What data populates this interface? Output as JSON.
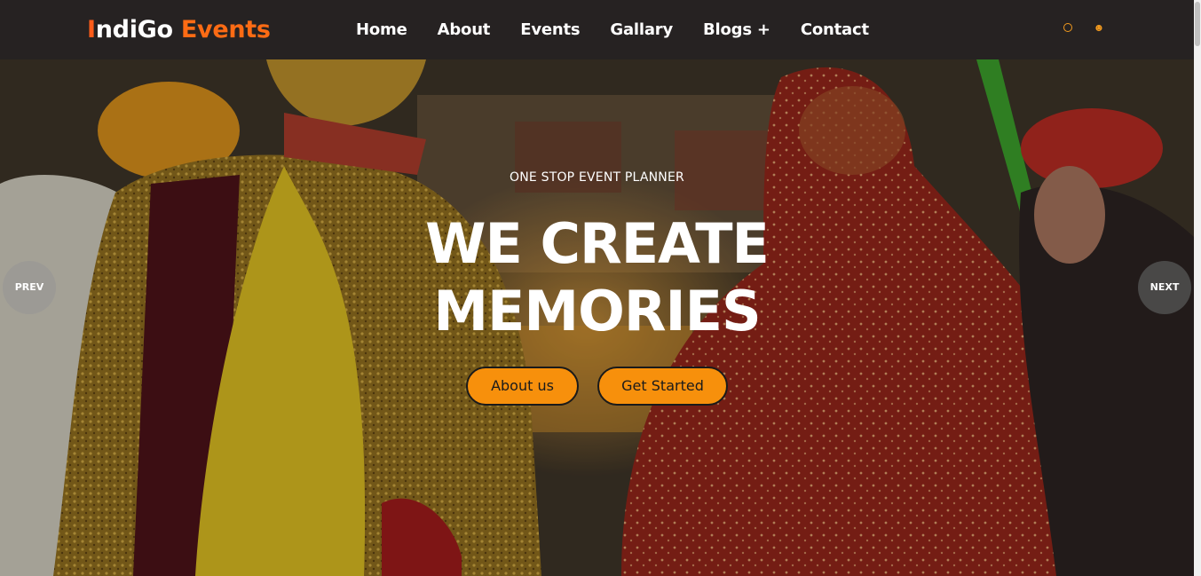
{
  "brand": {
    "first_letter": "I",
    "rest": "ndiGo ",
    "highlight": "Events"
  },
  "nav": {
    "items": [
      "Home",
      "About",
      "Events",
      "Gallary",
      "Blogs +",
      "Contact"
    ]
  },
  "header_icons": [
    "search-icon",
    "user-icon"
  ],
  "hero": {
    "tagline": "ONE STOP EVENT PLANNER",
    "headline_line1": "WE CREATE",
    "headline_line2": "MEMORIES",
    "buttons": {
      "about": "About us",
      "start": "Get Started"
    },
    "prev": "PREV",
    "next": "NEXT"
  },
  "colors": {
    "header_bg": "#262222",
    "brand_accent": "#fd6b14",
    "button_bg": "#f7900c",
    "icon_accent": "#f29a1e"
  }
}
